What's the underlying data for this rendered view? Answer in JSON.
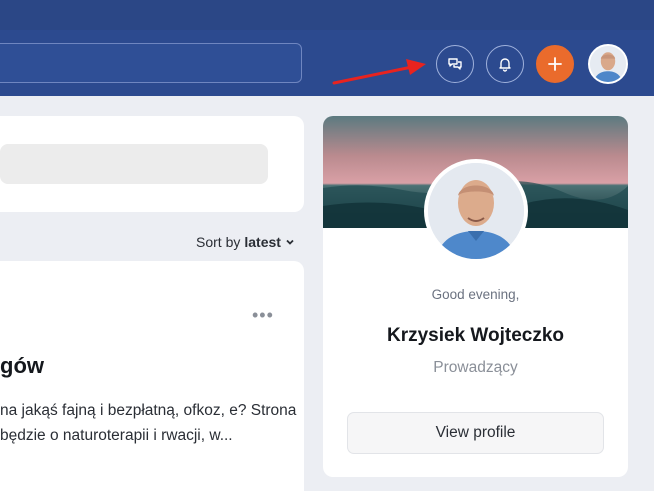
{
  "header": {
    "chat_icon": "chat-bubbles-icon",
    "bell_icon": "bell-icon",
    "plus_icon": "plus-icon",
    "accent_color": "#ea6b2c",
    "bar_color": "#2c4a8f"
  },
  "feed": {
    "sort_prefix": "Sort by",
    "sort_value": "latest",
    "post": {
      "title": "gów",
      "excerpt": "na jakąś fajną i bezpłatną, ofkoz, e? Strona będzie o naturoterapii i rwacji, w..."
    }
  },
  "profile": {
    "greeting": "Good evening,",
    "name": "Krzysiek Wojteczko",
    "role": "Prowadzący",
    "view_label": "View profile"
  }
}
